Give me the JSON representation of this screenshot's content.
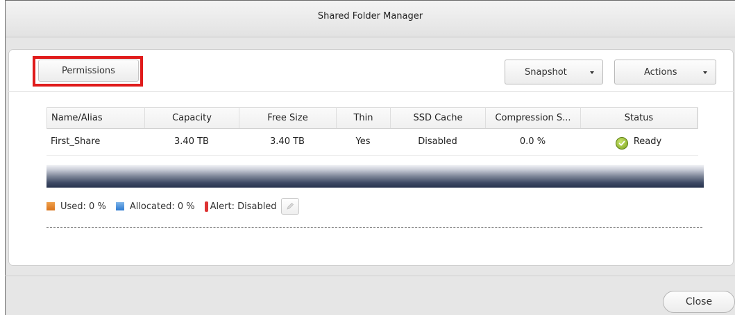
{
  "window": {
    "title": "Shared Folder Manager"
  },
  "toolbar": {
    "permissions_label": "Permissions",
    "snapshot_label": "Snapshot",
    "actions_label": "Actions"
  },
  "table": {
    "columns": [
      "Name/Alias",
      "Capacity",
      "Free Size",
      "Thin",
      "SSD Cache",
      "Compression S...",
      "Status"
    ],
    "rows": [
      {
        "name": "First_Share",
        "capacity": "3.40 TB",
        "free_size": "3.40 TB",
        "thin": "Yes",
        "ssd_cache": "Disabled",
        "compression": "0.0 %",
        "status": "Ready",
        "status_icon": "check-circle-icon"
      }
    ]
  },
  "usage": {
    "used_label": "Used: 0 %",
    "allocated_label": "Allocated: 0 %",
    "alert_label": "Alert: Disabled",
    "used_percent": 0,
    "allocated_percent": 0,
    "colors": {
      "used": "#e0822b",
      "allocated": "#3d86d6",
      "alert": "#d33333"
    }
  },
  "footer": {
    "close_label": "Close"
  },
  "highlight": {
    "color": "#e01b1b",
    "target": "permissions-button"
  }
}
